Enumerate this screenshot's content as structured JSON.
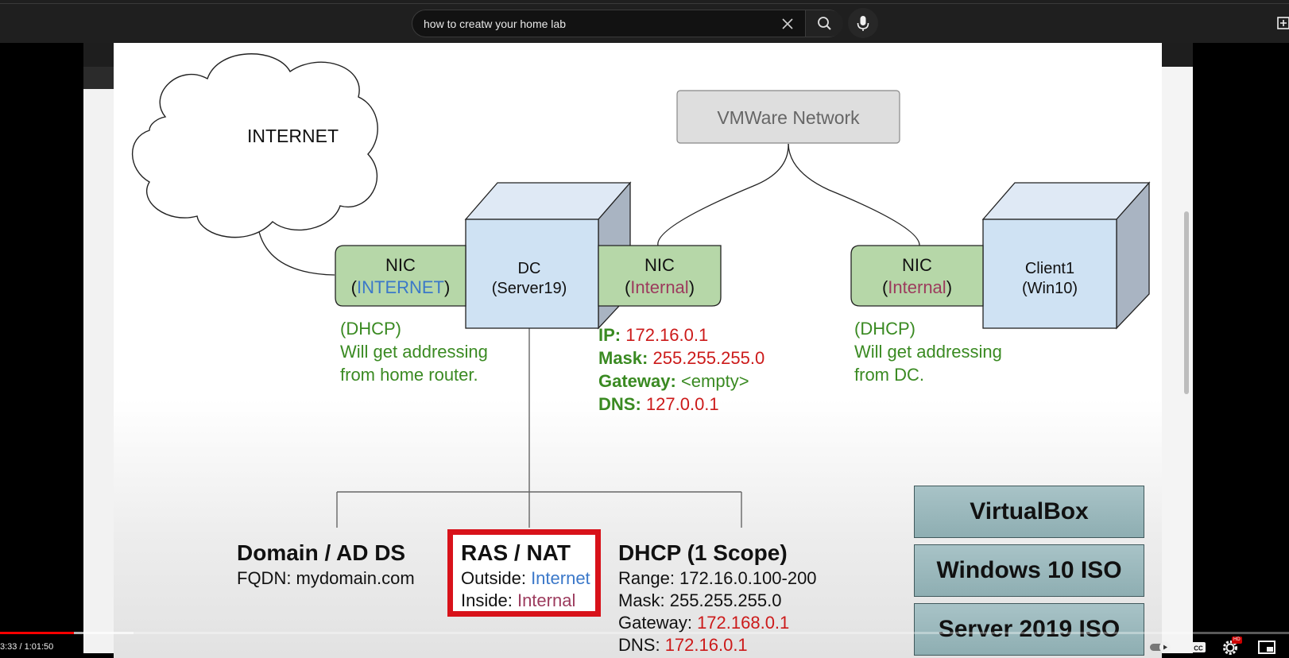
{
  "search": {
    "query": "how to creatw your home lab"
  },
  "icons": {
    "clear": "close-icon",
    "search": "search-icon",
    "mic": "microphone-icon",
    "create": "create-icon",
    "autoplay": "autoplay-toggle-icon",
    "captions": "captions-icon",
    "settings": "settings-gear-icon",
    "miniplayer": "miniplayer-icon"
  },
  "diagram": {
    "internet_cloud": "INTERNET",
    "vmware_network": "VMWare Network",
    "dc": {
      "line1": "DC",
      "line2": "(Server19)"
    },
    "client": {
      "line1": "Client1",
      "line2": "(Win10)"
    },
    "nic_internet": {
      "title": "NIC",
      "open": "(",
      "network": "INTERNET",
      "close": ")"
    },
    "nic_dc_internal": {
      "title": "NIC",
      "open": "(",
      "network": "Internal",
      "close": ")"
    },
    "nic_client_internal": {
      "title": "NIC",
      "open": "(",
      "network": "Internal",
      "close": ")"
    },
    "dc_internet_note": [
      "(DHCP)",
      "Will get addressing",
      "from home router."
    ],
    "client_note": [
      "(DHCP)",
      "Will get addressing",
      "from DC."
    ],
    "dc_internal_config": [
      {
        "label": "IP:",
        "value": "172.16.0.1"
      },
      {
        "label": "Mask:",
        "value": "255.255.255.0"
      },
      {
        "label": "Gateway:",
        "value": "<empty>"
      },
      {
        "label": "DNS:",
        "value": "127.0.0.1"
      }
    ],
    "services": {
      "ad": {
        "title": "Domain / AD DS",
        "fqdn": "FQDN: mydomain.com"
      },
      "ras": {
        "title": "RAS / NAT",
        "outside_label": "Outside:",
        "outside_value": "Internet",
        "inside_label": "Inside:",
        "inside_value": "Internal"
      },
      "dhcp": {
        "title": "DHCP (1 Scope)",
        "range": "Range: 172.16.0.100-200",
        "mask": "Mask: 255.255.255.0",
        "gateway_label": "Gateway:",
        "gateway_value": "172.168.0.1",
        "dns_label": "DNS:",
        "dns_value": "172.16.0.1"
      }
    },
    "software": [
      "VirtualBox",
      "Windows 10 ISO",
      "Server 2019 ISO"
    ]
  },
  "player": {
    "time": "3:33 / 1:01:50",
    "progress": 0.0575,
    "buffered": 0.1035,
    "hd_badge": "HD"
  },
  "colors": {
    "progress": "#ff0000",
    "note_green": "#3a8a22",
    "value_red": "#cc1a1a",
    "internet_blue": "#3b78c9",
    "internal_plum": "#9c3b5d",
    "nic_fill": "#b6d7a8",
    "server_fill": "#cfe2f3",
    "ras_border": "#d8121a"
  }
}
